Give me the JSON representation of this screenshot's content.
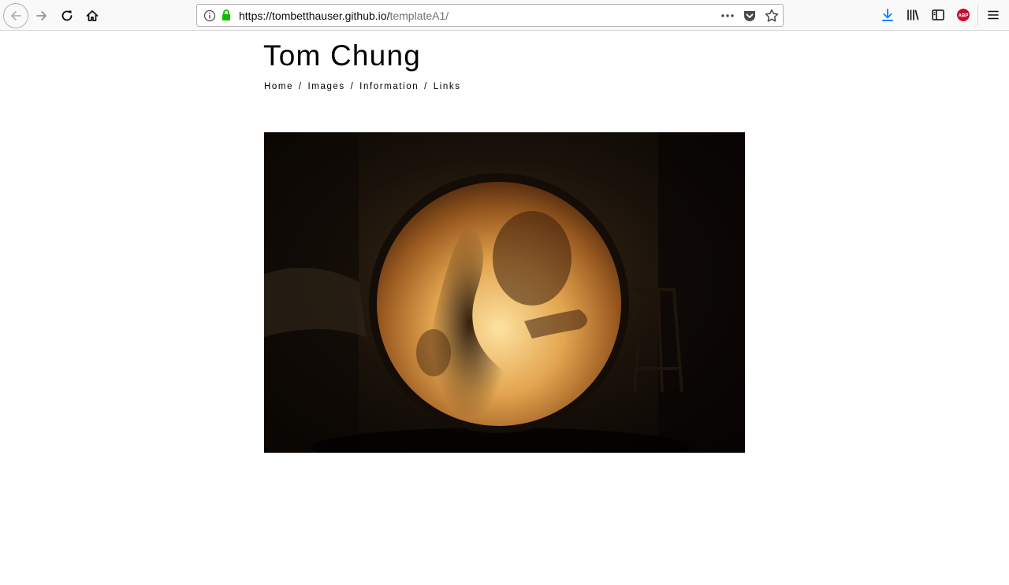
{
  "browser": {
    "url": {
      "host": "https://tombetthauser.github.io/",
      "path": "templateA1/"
    },
    "icons": {
      "back": "back-arrow-icon",
      "forward": "forward-arrow-icon",
      "reload": "reload-icon",
      "home": "home-icon",
      "info": "info-icon",
      "lock": "lock-icon",
      "more": "more-dots-icon",
      "pocket": "pocket-icon",
      "bookmark": "star-icon",
      "downloads": "download-icon",
      "library": "library-icon",
      "sidebar": "sidebar-icon",
      "adblock": "adblock-icon",
      "menu": "hamburger-menu-icon"
    },
    "colors": {
      "lock_green": "#12bc00",
      "download_blue": "#0a84ff",
      "abp_red": "#c70d2c"
    }
  },
  "site": {
    "title": "Tom Chung",
    "nav": [
      {
        "label": "Home"
      },
      {
        "label": "Images"
      },
      {
        "label": "Information"
      },
      {
        "label": "Links"
      }
    ],
    "nav_separator": "/",
    "adblock_badge": "ABP"
  }
}
